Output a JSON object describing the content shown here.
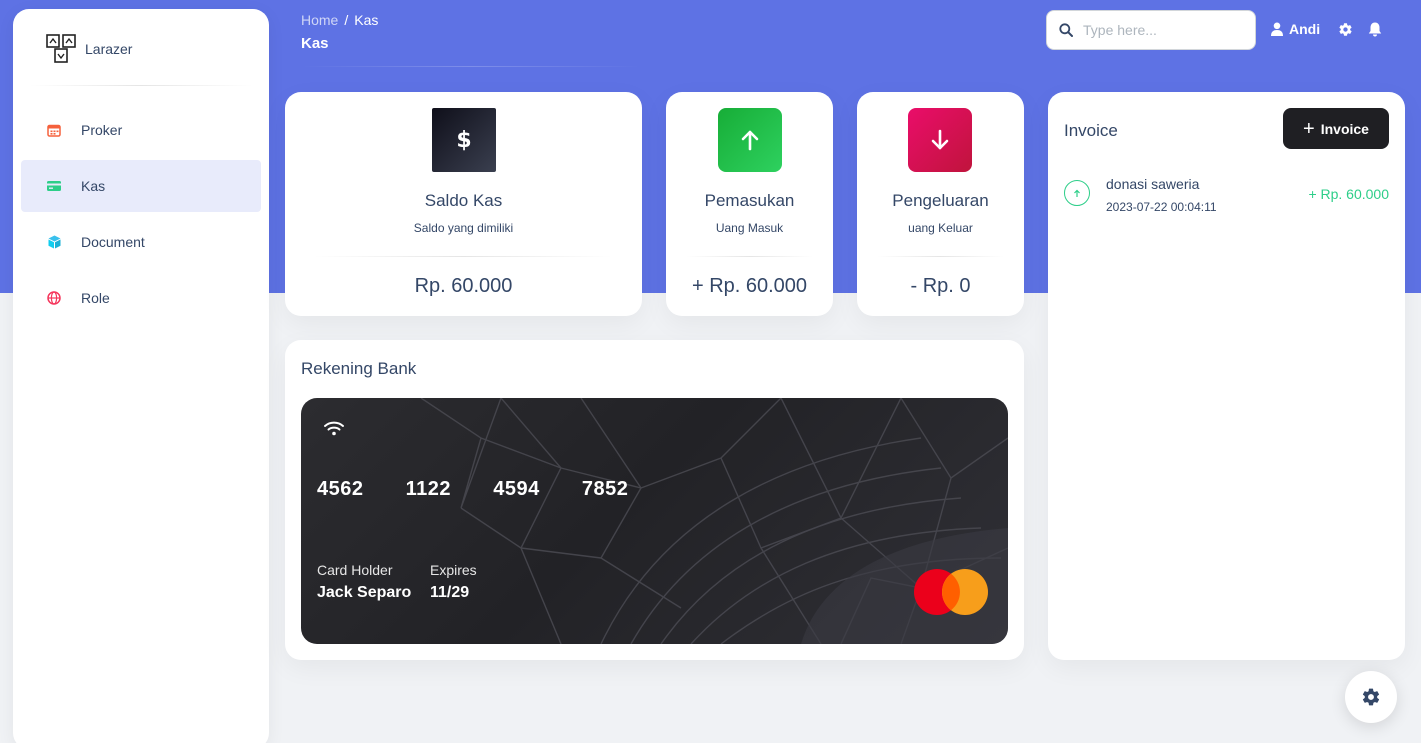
{
  "brand": {
    "name": "Larazer"
  },
  "sidebar": {
    "items": [
      {
        "label": "Proker",
        "icon": "calendar-icon",
        "active": false
      },
      {
        "label": "Kas",
        "icon": "credit-card-icon",
        "active": true
      },
      {
        "label": "Document",
        "icon": "box-icon",
        "active": false
      },
      {
        "label": "Role",
        "icon": "globe-icon",
        "active": false
      }
    ]
  },
  "header": {
    "breadcrumb": {
      "home": "Home",
      "separator": "/",
      "current": "Kas"
    },
    "title": "Kas",
    "search": {
      "placeholder": "Type here...",
      "value": ""
    },
    "user": "Andi"
  },
  "stats": {
    "saldo": {
      "title": "Saldo Kas",
      "subtitle": "Saldo yang dimiliki",
      "value": "Rp. 60.000",
      "icon": "dollar-icon"
    },
    "pemasukan": {
      "title": "Pemasukan",
      "subtitle": "Uang Masuk",
      "value": "+ Rp. 60.000",
      "icon": "arrow-up-icon"
    },
    "pengeluaran": {
      "title": "Pengeluaran",
      "subtitle": "uang Keluar",
      "value": "- Rp. 0",
      "icon": "arrow-down-icon"
    }
  },
  "bank": {
    "title": "Rekening Bank",
    "card_number": "4562   1122   4594   7852",
    "holder_label": "Card Holder",
    "holder_name": "Jack Separo",
    "expires_label": "Expires",
    "expires_value": "11/29"
  },
  "invoice": {
    "title": "Invoice",
    "button_label": "Invoice",
    "items": [
      {
        "name": "donasi saweria",
        "date": "2023-07-22 00:04:11",
        "amount": "+ Rp. 60.000"
      }
    ]
  },
  "colors": {
    "primary": "#5e72e4",
    "success": "#2dce89",
    "dark": "#1f1f23",
    "pink": "#d6175a"
  }
}
